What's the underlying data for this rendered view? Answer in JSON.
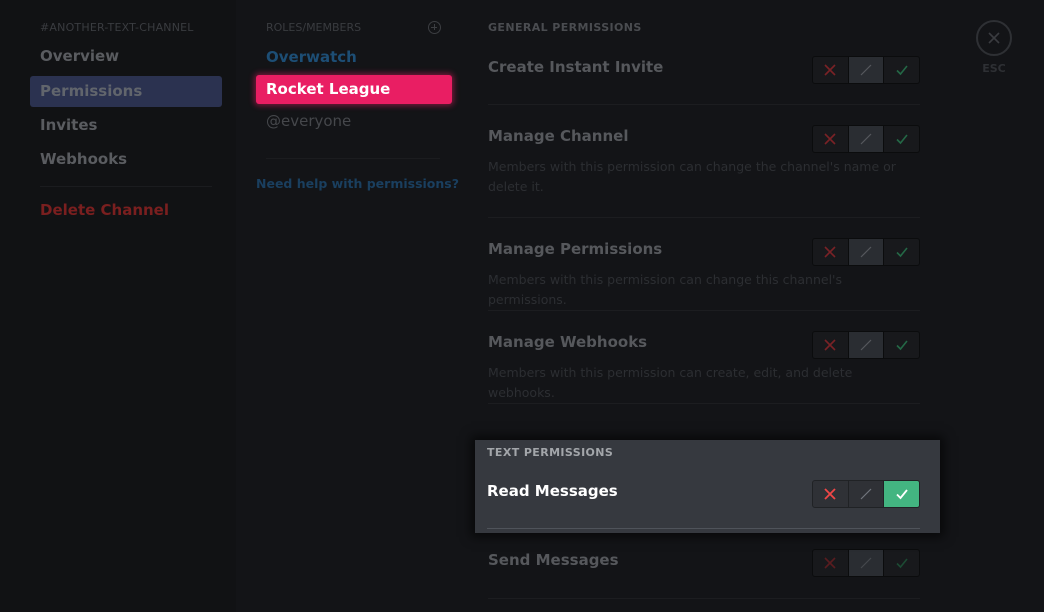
{
  "sidebar": {
    "header": "#another-text-channel",
    "items": [
      {
        "label": "Overview",
        "active": false
      },
      {
        "label": "Permissions",
        "active": true
      },
      {
        "label": "Invites",
        "active": false
      },
      {
        "label": "Webhooks",
        "active": false
      }
    ],
    "delete_label": "Delete Channel"
  },
  "roles": {
    "header": "Roles/Members",
    "add_icon": "plus-circle-icon",
    "items": [
      {
        "label": "Overwatch",
        "selected": false,
        "color": "#1d4e75"
      },
      {
        "label": "Rocket League",
        "selected": true,
        "color": "#e91e63"
      },
      {
        "label": "@everyone",
        "selected": false
      }
    ],
    "help_link": "Need help with permissions?"
  },
  "main": {
    "general_header": "General Permissions",
    "general": [
      {
        "title": "Create Instant Invite",
        "description": "",
        "state": "inherit"
      },
      {
        "title": "Manage Channel",
        "description": "Members with this permission can change the channel's name or delete it.",
        "state": "inherit"
      },
      {
        "title": "Manage Permissions",
        "description": "Members with this permission can change this channel's permissions.",
        "state": "inherit"
      },
      {
        "title": "Manage Webhooks",
        "description": "Members with this permission can create, edit, and delete webhooks.",
        "state": "inherit"
      }
    ],
    "text_header": "Text Permissions",
    "text": [
      {
        "title": "Read Messages",
        "description": "",
        "state": "allow"
      },
      {
        "title": "Send Messages",
        "description": "",
        "state": "inherit"
      }
    ]
  },
  "close": {
    "label": "ESC",
    "icon": "close-icon"
  },
  "colors": {
    "deny": "#f04747",
    "allow": "#43b581",
    "accent_role": "#e91e63",
    "active_nav": "#2b3250"
  }
}
